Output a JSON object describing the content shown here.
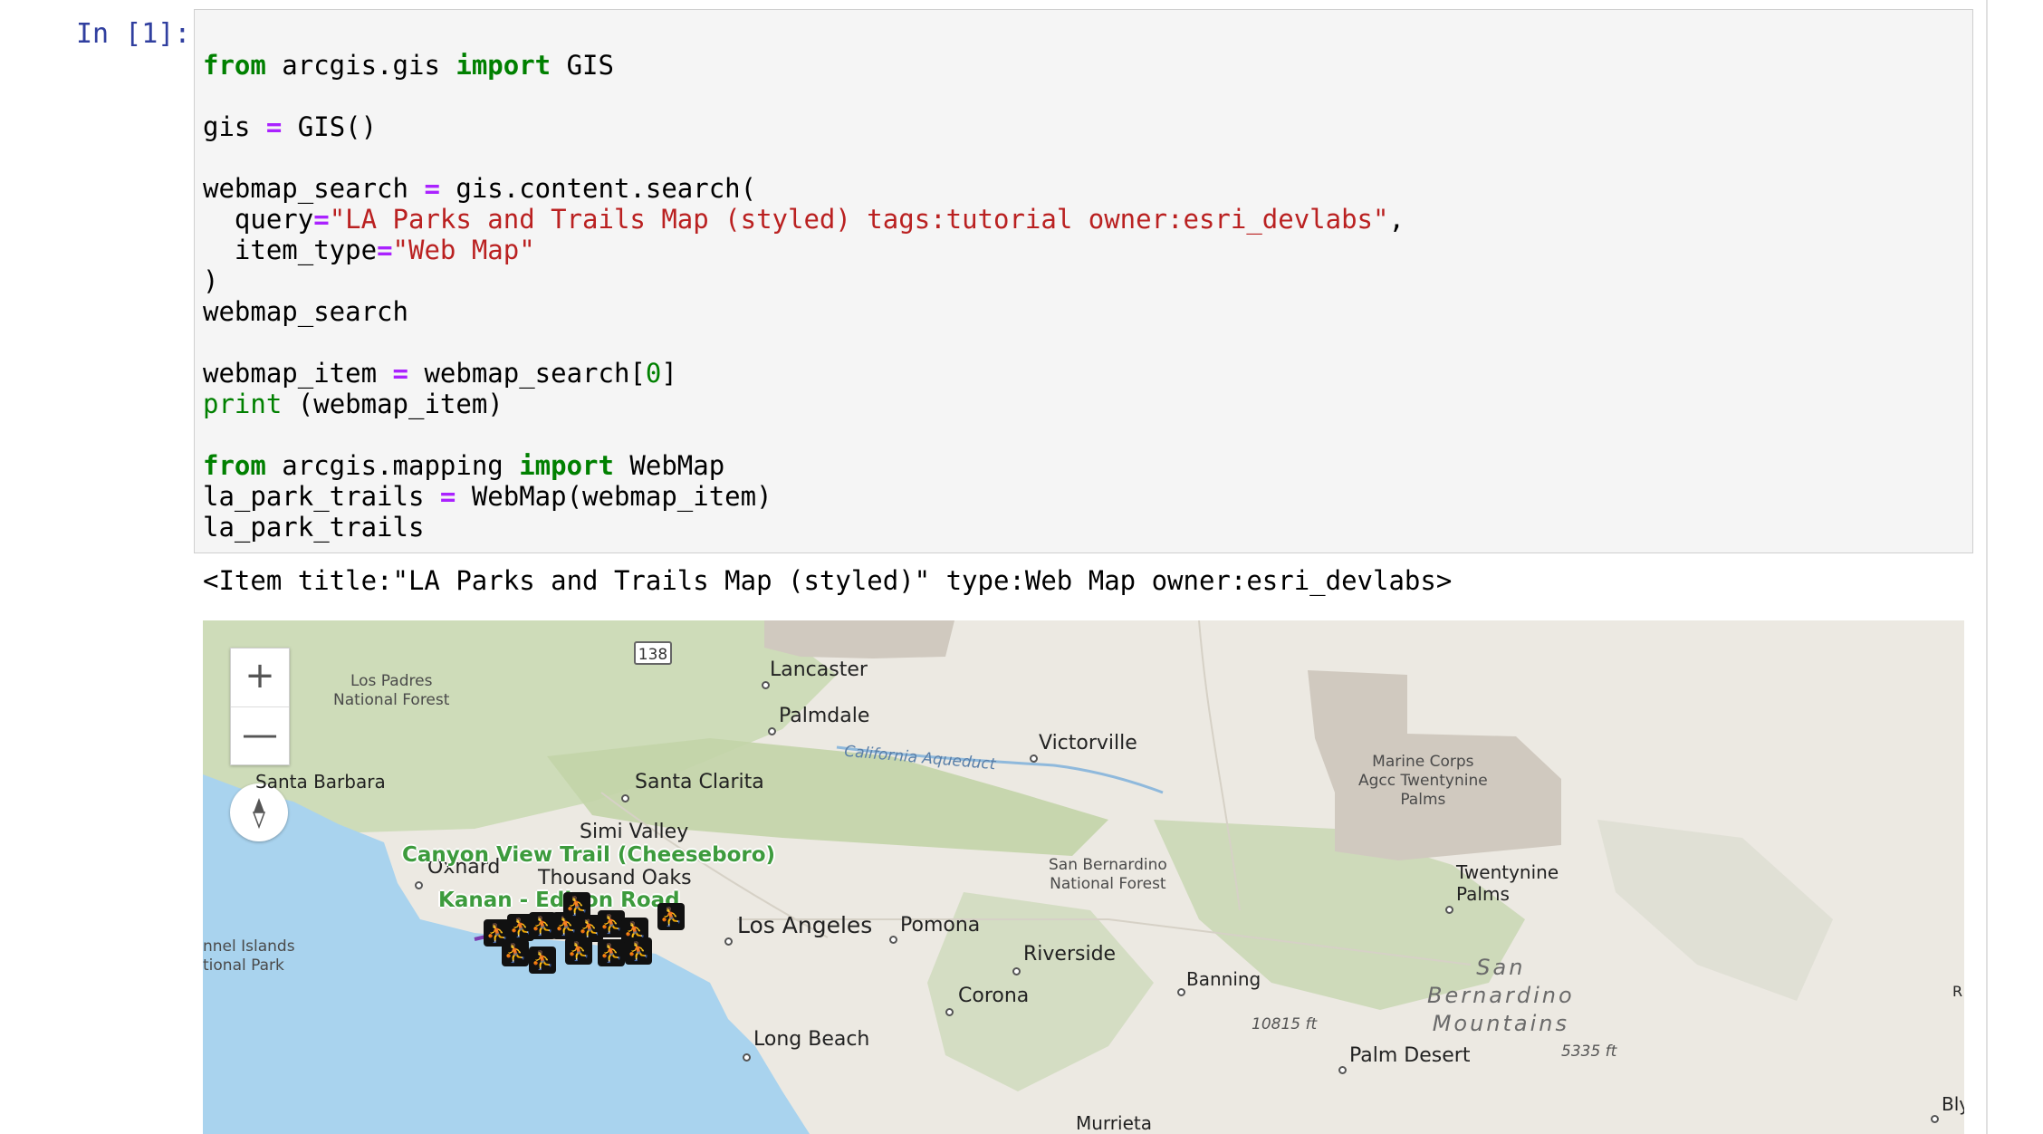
{
  "prompt": "In [1]:",
  "code": {
    "l1_kw1": "from",
    "l1_mod": " arcgis.gis ",
    "l1_kw2": "import",
    "l1_name": " GIS",
    "l2_a": "gis ",
    "l2_op": "=",
    "l2_b": " GIS()",
    "l3_a": "webmap_search ",
    "l3_op": "=",
    "l3_b": " gis.content.search(",
    "l4_a": "  query",
    "l4_op": "=",
    "l4_str": "\"LA Parks and Trails Map (styled) tags:tutorial owner:esri_devlabs\"",
    "l4_b": ",",
    "l5_a": "  item_type",
    "l5_op": "=",
    "l5_str": "\"Web Map\"",
    "l6": ")",
    "l7": "webmap_search",
    "l8_a": "webmap_item ",
    "l8_op": "=",
    "l8_b": " webmap_search[",
    "l8_num": "0",
    "l8_c": "]",
    "l9_bi": "print",
    "l9_b": " (webmap_item)",
    "l10_kw1": "from",
    "l10_mod": " arcgis.mapping ",
    "l10_kw2": "import",
    "l10_name": " WebMap",
    "l11_a": "la_park_trails ",
    "l11_op": "=",
    "l11_b": " WebMap(webmap_item)",
    "l12": "la_park_trails"
  },
  "output": "<Item title:\"LA Parks and Trails Map (styled)\" type:Web Map owner:esri_devlabs>",
  "map": {
    "highway": "138",
    "zoom_in": "+",
    "zoom_out": "—",
    "cities": {
      "lancaster": "Lancaster",
      "palmdale": "Palmdale",
      "victorville": "Victorville",
      "santa_barbara": "Santa Barbara",
      "santa_clarita": "Santa Clarita",
      "simi_valley": "Simi Valley",
      "oxnard": "Oxnard",
      "thousand_oaks": "Thousand Oaks",
      "los_angeles": "Los Angeles",
      "pomona": "Pomona",
      "riverside": "Riverside",
      "corona": "Corona",
      "banning": "Banning",
      "long_beach": "Long Beach",
      "palm_desert": "Palm Desert",
      "twentynine_palms_1": "Twentynine",
      "twentynine_palms_2": "Palms",
      "murrieta": "Murrieta",
      "blythe": "Bly"
    },
    "areas": {
      "los_padres_1": "Los Padres",
      "los_padres_2": "National Forest",
      "san_bernardino_1": "San Bernardino",
      "san_bernardino_2": "National Forest",
      "marine_1": "Marine Corps",
      "marine_2": "Agcc Twentynine",
      "marine_3": "Palms",
      "channel_1": "nnel Islands",
      "channel_2": "tional Park",
      "san_bern_mtn_1": "San",
      "san_bern_mtn_2": "Bernardino",
      "san_bern_mtn_3": "Mountains",
      "aqueduct": "California Aqueduct",
      "elev1": "10815 ft",
      "elev2": "5335 ft",
      "edge_r": "R"
    },
    "trails": {
      "canyon_view": "Canyon View Trail (Cheeseboro)",
      "kanan": "Kanan - Edison Road"
    },
    "colors": {
      "ocean": "#a9d3ee",
      "land": "#ece9e2",
      "forest": "#c9d9b2",
      "military": "#d0c9bf",
      "trail": "#3d9b3d"
    }
  }
}
